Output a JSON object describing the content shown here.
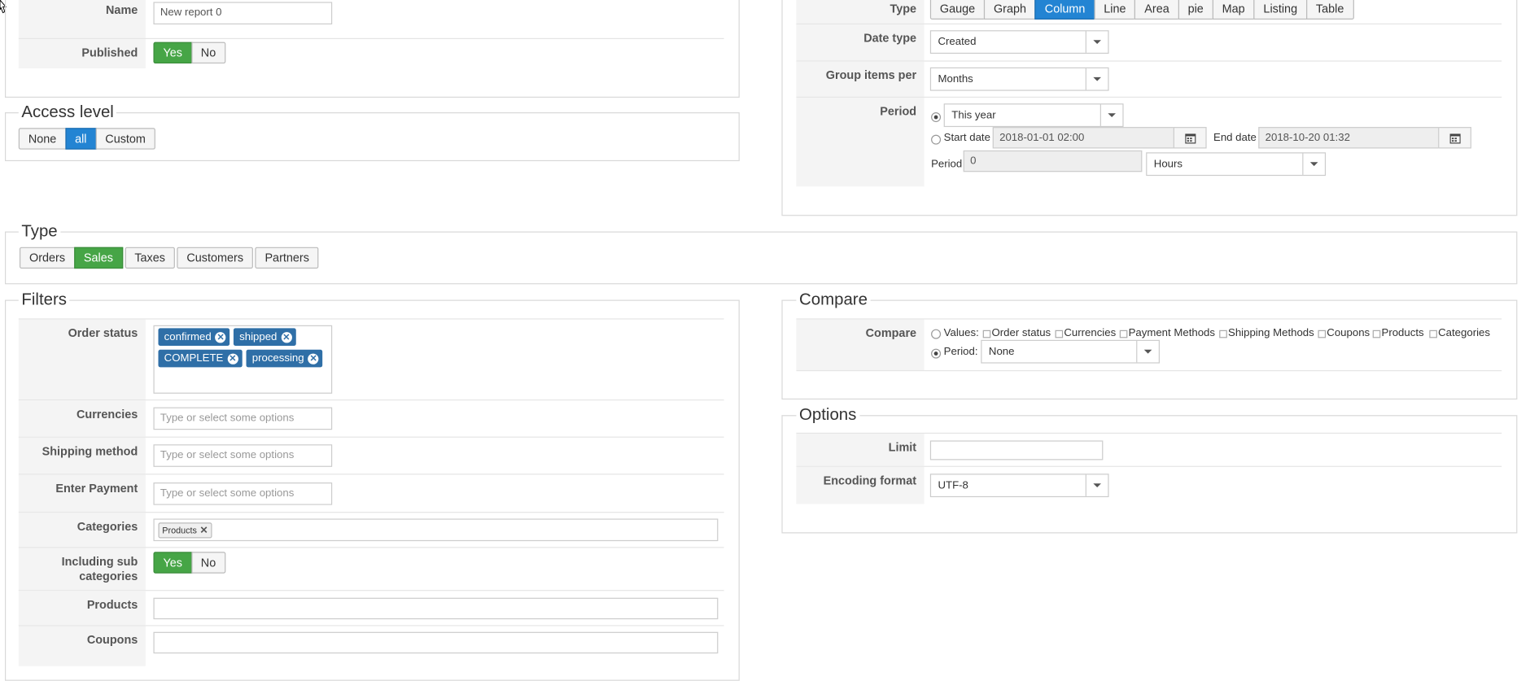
{
  "general": {
    "name_label": "Name",
    "name_value": "New report 0",
    "published_label": "Published",
    "published_yes": "Yes",
    "published_no": "No"
  },
  "access": {
    "legend": "Access level",
    "buttons": [
      "None",
      "all",
      "Custom"
    ],
    "active": "all"
  },
  "display": {
    "type_label": "Type",
    "type_options": [
      "Gauge",
      "Graph",
      "Column",
      "Line",
      "Area",
      "pie",
      "Map",
      "Listing",
      "Table"
    ],
    "type_active": "Column",
    "date_type_label": "Date type",
    "date_type_value": "Created",
    "group_label": "Group items per",
    "group_value": "Months",
    "period_label": "Period",
    "period_value": "This year",
    "start_date_label": "Start date",
    "start_date_value": "2018-01-01 02:00",
    "end_date_label": "End date",
    "end_date_value": "2018-10-20 01:32",
    "period2_label": "Period",
    "period2_value": "0",
    "period2_unit": "Hours"
  },
  "type_section": {
    "legend": "Type",
    "buttons": [
      "Orders",
      "Sales",
      "Taxes",
      "Customers",
      "Partners"
    ],
    "active": "Sales"
  },
  "filters": {
    "legend": "Filters",
    "order_status_label": "Order status",
    "order_status_tags": [
      "confirmed",
      "shipped",
      "COMPLETE",
      "processing"
    ],
    "currencies_label": "Currencies",
    "shipping_label": "Shipping method",
    "payment_label": "Enter Payment",
    "placeholder": "Type or select some options",
    "categories_label": "Categories",
    "categories_tag": "Products",
    "subcat_label_1": "Including sub",
    "subcat_label_2": "categories",
    "subcat_yes": "Yes",
    "subcat_no": "No",
    "products_label": "Products",
    "coupons_label": "Coupons"
  },
  "compare": {
    "legend": "Compare",
    "label": "Compare",
    "values_label": "Values:",
    "checkboxes": [
      "Order status",
      "Currencies",
      "Payment Methods",
      "Shipping Methods",
      "Coupons",
      "Products",
      "Categories"
    ],
    "period_label": "Period:",
    "period_value": "None"
  },
  "options": {
    "legend": "Options",
    "limit_label": "Limit",
    "limit_value": "",
    "encoding_label": "Encoding format",
    "encoding_value": "UTF-8"
  },
  "colors": {
    "green": "#46a546",
    "blue": "#2384d3",
    "tag": "#2f6fa7"
  }
}
